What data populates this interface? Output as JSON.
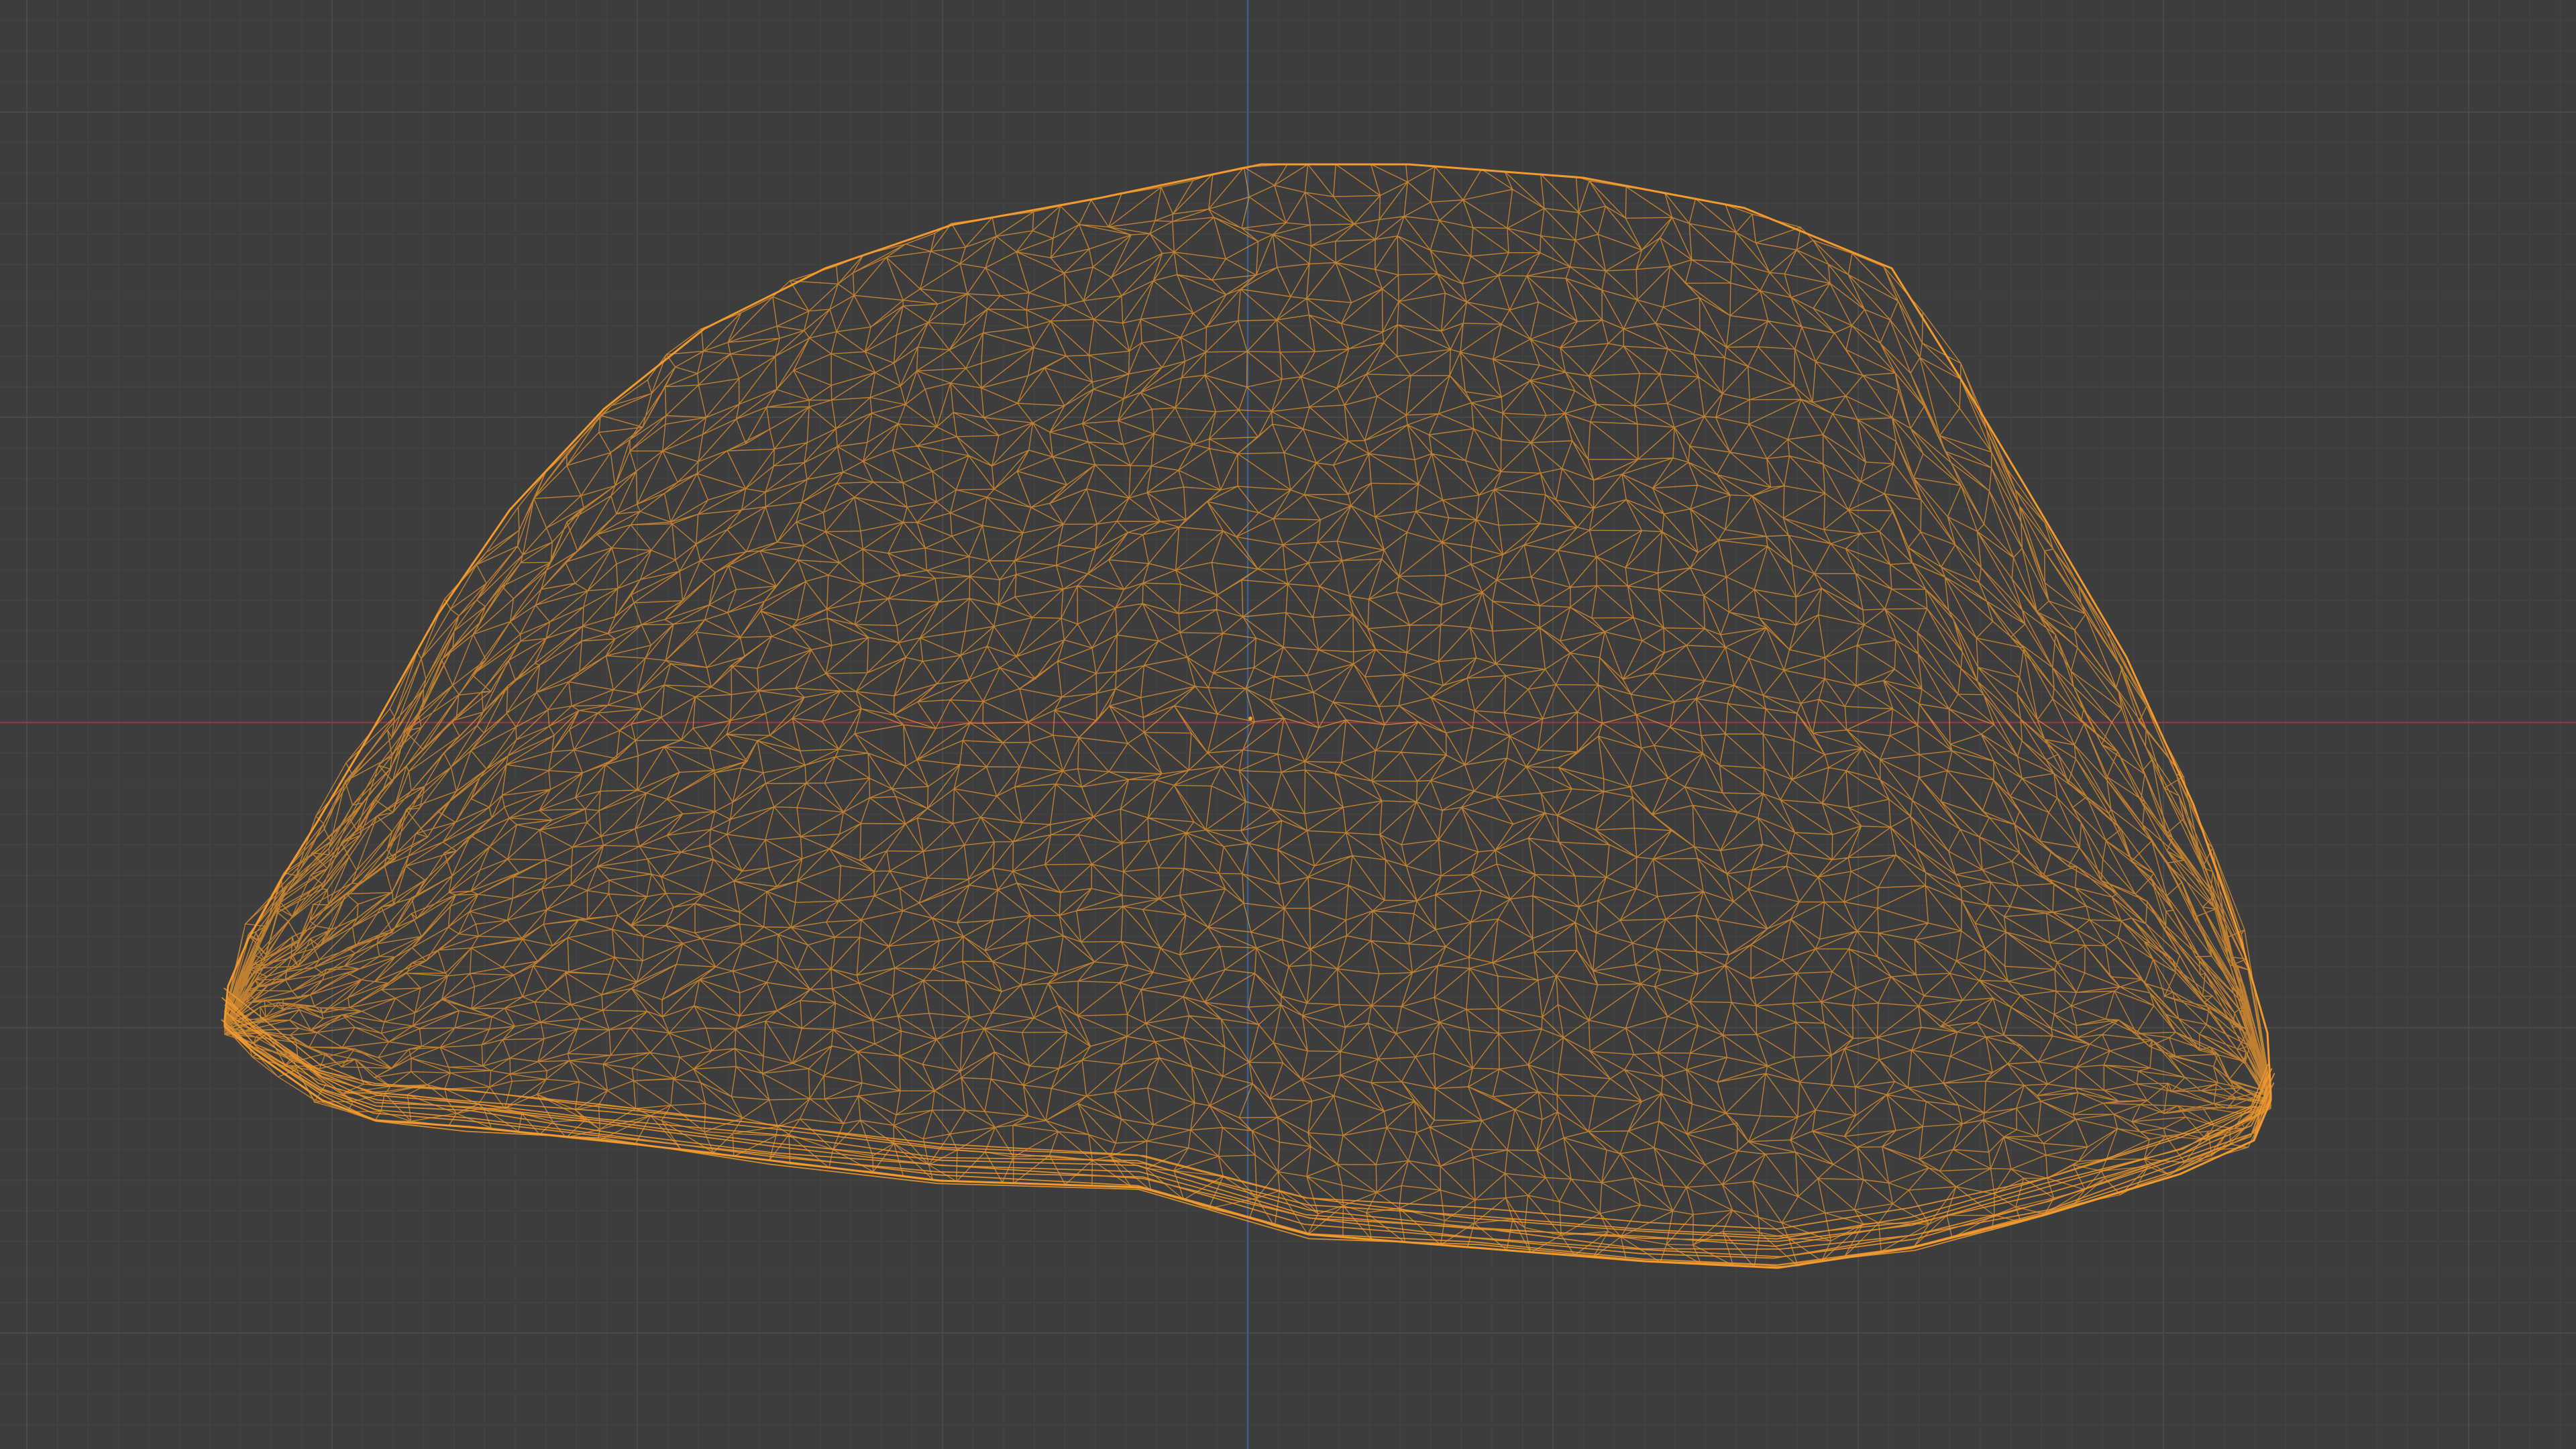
{
  "viewport": {
    "view_mode": "wireframe",
    "background_color": "#3d3d3d",
    "grid_minor_color": "#434343",
    "grid_major_color": "#4a4a4a",
    "x_axis_color": "#8a3b44",
    "y_axis_color": "#3c5f8a",
    "selection_color": "#f29a2e",
    "object": {
      "selected": true,
      "icon": "mesh-object-icon"
    }
  }
}
